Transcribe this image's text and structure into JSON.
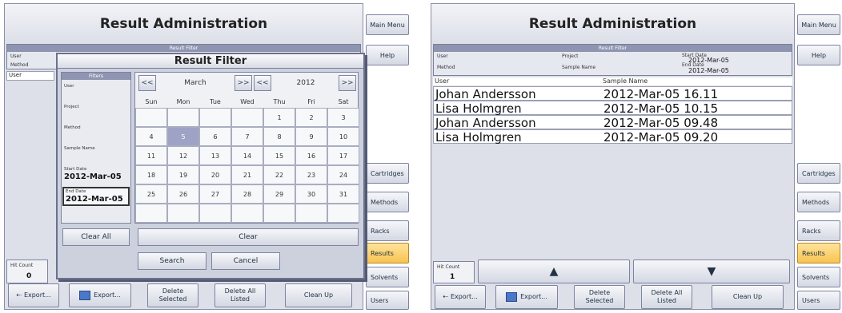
{
  "title": "Result Administration",
  "filter": {
    "head": "Result Filter",
    "user": "User",
    "method": "Method",
    "project": "Project",
    "sample_name": "Sample Name",
    "start_date_label": "Start Date",
    "start_date": "2012-Mar-05",
    "end_date_label": "End Date",
    "end_date": "2012-Mar-05"
  },
  "left": {
    "user_col": "User",
    "hit_count_label": "Hit Count",
    "hit_count": "0"
  },
  "dialog": {
    "title": "Result Filter",
    "filters_head": "Filters",
    "rows": [
      "User",
      "Project",
      "Method",
      "Sample Name"
    ],
    "start_label": "Start Date",
    "start_value": "2012-Mar-05",
    "end_label": "End Date",
    "end_value": "2012-Mar-05",
    "prev_month": "<<",
    "month": "March",
    "next_month": ">>",
    "prev_year": "<<",
    "year": "2012",
    "next_year": ">>",
    "days": [
      "Sun",
      "Mon",
      "Tue",
      "Wed",
      "Thu",
      "Fri",
      "Sat"
    ],
    "weeks": [
      [
        "",
        "",
        "",
        "",
        "1",
        "2",
        "3"
      ],
      [
        "4",
        "5",
        "6",
        "7",
        "8",
        "9",
        "10"
      ],
      [
        "11",
        "12",
        "13",
        "14",
        "15",
        "16",
        "17"
      ],
      [
        "18",
        "19",
        "20",
        "21",
        "22",
        "23",
        "24"
      ],
      [
        "25",
        "26",
        "27",
        "28",
        "29",
        "30",
        "31"
      ],
      [
        "",
        "",
        "",
        "",
        "",
        "",
        ""
      ]
    ],
    "selected_day": "5",
    "clear_all": "Clear All",
    "clear": "Clear",
    "search": "Search",
    "cancel": "Cancel"
  },
  "side": {
    "main_menu": "Main Menu",
    "help": "Help",
    "cartridges": "Cartridges",
    "methods": "Methods",
    "racks": "Racks",
    "results": "Results",
    "solvents": "Solvents",
    "users": "Users"
  },
  "bottom": {
    "export1": "Export...",
    "export2": "Export...",
    "delete_selected": "Delete Selected",
    "delete_all": "Delete All Listed",
    "clean_up": "Clean Up"
  },
  "right": {
    "user_col": "User",
    "sample_col": "Sample Name",
    "hit_count_label": "Hit Count",
    "hit_count": "1",
    "up_arrow": "▲",
    "down_arrow": "▼",
    "rows": [
      {
        "user": "Johan Andersson",
        "date": "2012-Mar-05 16.11"
      },
      {
        "user": "Lisa Holmgren",
        "date": "2012-Mar-05 10.15"
      },
      {
        "user": "Johan Andersson",
        "date": "2012-Mar-05 09.48"
      },
      {
        "user": "Lisa Holmgren",
        "date": "2012-Mar-05 09.20"
      }
    ]
  }
}
